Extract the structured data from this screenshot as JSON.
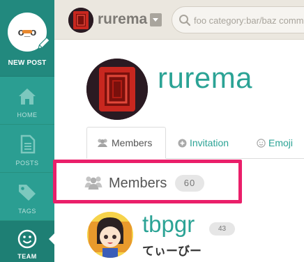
{
  "sidebar": {
    "new_post_label": "NEW POST",
    "logo_text": "o_o",
    "items": [
      {
        "label": "HOME",
        "icon": "home-icon"
      },
      {
        "label": "POSTS",
        "icon": "document-icon"
      },
      {
        "label": "TAGS",
        "icon": "tags-icon"
      },
      {
        "label": "TEAM",
        "icon": "smiley-icon",
        "active": true
      }
    ]
  },
  "topbar": {
    "team_name": "rurema",
    "search_placeholder": "foo category:bar/baz comm"
  },
  "team": {
    "name": "rurema"
  },
  "tabs": [
    {
      "label": "Members",
      "icon": "users-icon",
      "active": true
    },
    {
      "label": "Invitation",
      "icon": "plus-circle-icon"
    },
    {
      "label": "Emoji",
      "icon": "smiley-icon"
    }
  ],
  "members_section": {
    "title": "Members",
    "count": "60"
  },
  "members": [
    {
      "handle": "tbpgr",
      "count": "43",
      "name": "てぃーびー"
    }
  ],
  "colors": {
    "sidebar": "#2b9e92",
    "accent": "#2ba395",
    "highlight": "#ea1f6a",
    "topbar": "#ebe7df"
  }
}
